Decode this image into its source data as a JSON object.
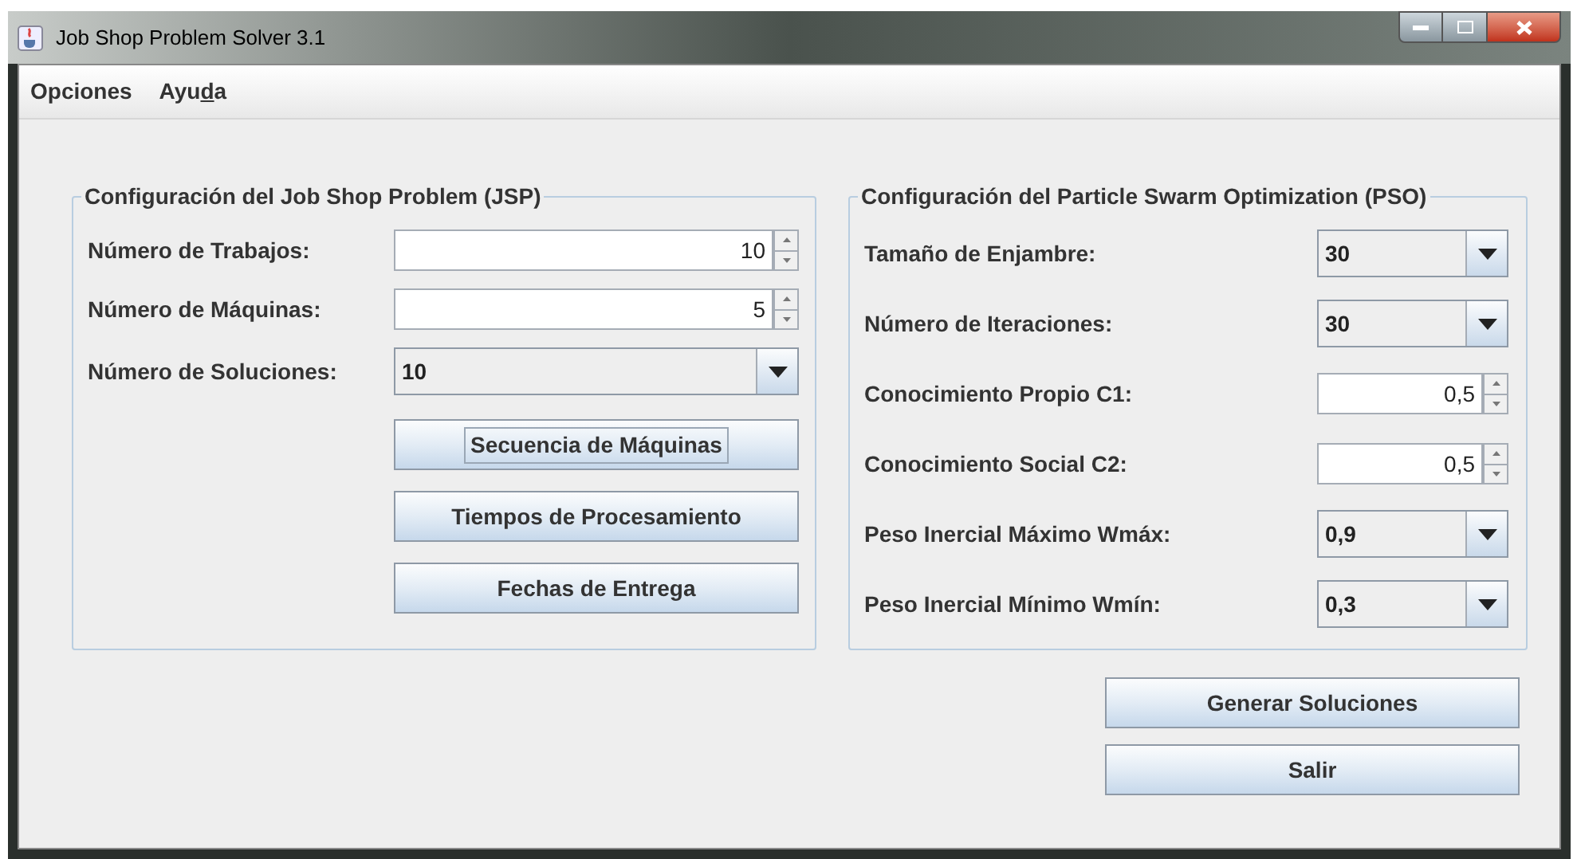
{
  "window": {
    "title": "Job Shop Problem Solver 3.1"
  },
  "menu": [
    {
      "parts": [
        {
          "text": "Opciones",
          "underlined": false
        }
      ]
    },
    {
      "parts": [
        {
          "text": "Ayu",
          "underlined": false
        },
        {
          "text": "d",
          "underlined": true
        },
        {
          "text": "a",
          "underlined": false
        }
      ]
    }
  ],
  "jsp": {
    "title": "Configuración del Job Shop Problem (JSP)",
    "fields": [
      {
        "kind": "spinner",
        "label": "Número de Trabajos:",
        "value": "10"
      },
      {
        "kind": "spinner",
        "label": "Número de Máquinas:",
        "value": "5"
      },
      {
        "kind": "combo",
        "label": "Número de Soluciones:",
        "value": "10"
      }
    ],
    "buttons": [
      {
        "label": "Secuencia de Máquinas",
        "focused": true
      },
      {
        "label": "Tiempos de Procesamiento",
        "focused": false
      },
      {
        "label": "Fechas de Entrega",
        "focused": false
      }
    ]
  },
  "pso": {
    "title": "Configuración del Particle Swarm Optimization (PSO)",
    "fields": [
      {
        "kind": "combo",
        "label": "Tamaño de Enjambre:",
        "value": "30"
      },
      {
        "kind": "combo",
        "label": "Número de Iteraciones:",
        "value": "30"
      },
      {
        "kind": "spinner",
        "label": "Conocimiento Propio C1:",
        "value": "0,5"
      },
      {
        "kind": "spinner",
        "label": "Conocimiento Social C2:",
        "value": "0,5"
      },
      {
        "kind": "combo",
        "label": "Peso Inercial Máximo Wmáx:",
        "value": "0,9"
      },
      {
        "kind": "combo",
        "label": "Peso Inercial Mínimo Wmín:",
        "value": "0,3"
      }
    ]
  },
  "actions": [
    {
      "label": "Generar Soluciones",
      "focused": false
    },
    {
      "label": "Salir",
      "focused": false
    }
  ]
}
